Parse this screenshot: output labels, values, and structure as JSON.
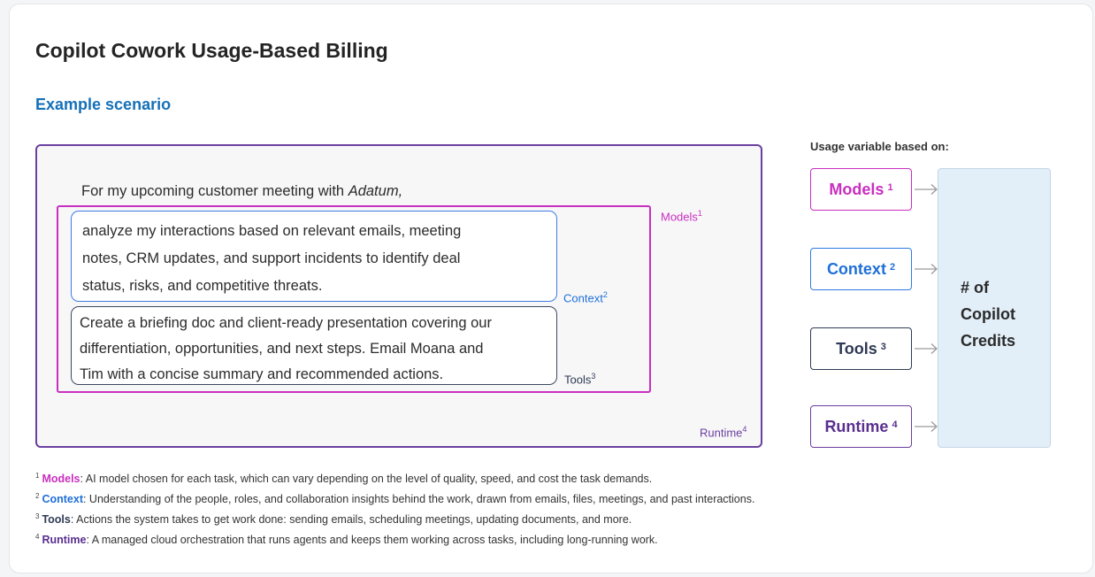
{
  "title": "Copilot Cowork Usage-Based Billing",
  "subtitle": "Example scenario",
  "prompt": {
    "intro": "For my upcoming customer meeting with ",
    "intro_customer": "Adatum,",
    "context_lines": [
      "analyze my interactions based on relevant emails, meeting",
      "notes, CRM updates, and support incidents to identify deal",
      "status, risks, and competitive threats."
    ],
    "tools_lines": [
      "Create a briefing doc and client-ready presentation covering our",
      "differentiation, opportunities, and next steps. Email Moana and",
      "Tim with a concise summary and recommended actions."
    ]
  },
  "tags": {
    "models": "Models",
    "models_num": "1",
    "context": "Context",
    "context_num": "2",
    "tools": "Tools",
    "tools_num": "3",
    "runtime": "Runtime",
    "runtime_num": "4"
  },
  "usage_label": "Usage variable based on:",
  "variables": [
    {
      "label": "Models",
      "num": "1"
    },
    {
      "label": "Context",
      "num": "2"
    },
    {
      "label": "Tools",
      "num": "3"
    },
    {
      "label": "Runtime",
      "num": "4"
    }
  ],
  "credits_lines": [
    "# of",
    "Copilot",
    "Credits"
  ],
  "footnotes": [
    {
      "num": "1",
      "term": "Models",
      "text": ": AI model chosen for each task, which can vary depending on the level of quality, speed, and cost the task demands."
    },
    {
      "num": "2",
      "term": "Context",
      "text": ": Understanding of the people, roles, and collaboration insights behind the work, drawn from emails, files, meetings, and past interactions."
    },
    {
      "num": "3",
      "term": "Tools",
      "text": ": Actions the system takes to get work done: sending emails, scheduling meetings, updating documents, and more."
    },
    {
      "num": "4",
      "term": "Runtime",
      "text": ": A managed cloud orchestration that runs agents and keeps them working across tasks, including long-running work."
    }
  ],
  "colors": {
    "models": "#c92fc0",
    "context": "#1f6fd8",
    "tools": "#2f3a55",
    "runtime": "#6b3fa0",
    "heading_blue": "#1570b8",
    "credits_bg": "#e2eef8"
  }
}
